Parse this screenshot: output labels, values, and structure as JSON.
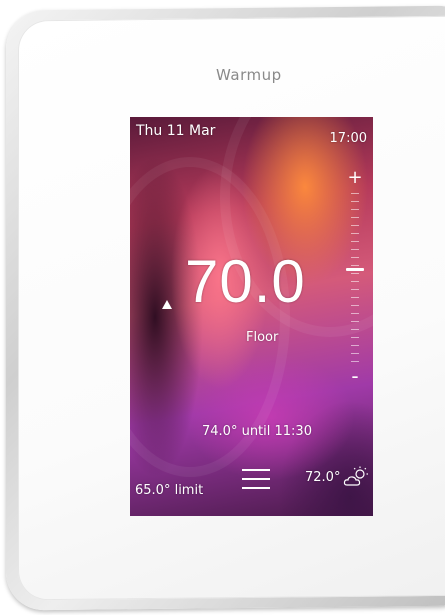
{
  "brand": "Warmup",
  "screen": {
    "date": "Thu 11 Mar",
    "time": "17:00",
    "setpoint": "70.0",
    "trend": "rising",
    "mode": "Floor",
    "schedule": "74.0° until 11:30",
    "limit": "65.0° limit",
    "outdoor_temp": "72.0°",
    "weather_icon": "partly-cloudy-icon",
    "menu_icon": "hamburger-menu-icon",
    "plus_label": "+",
    "minus_label": "-",
    "slider_level": 0.55
  },
  "colors": {
    "screen_text": "#ffffff",
    "brand_text": "#8a8a8a",
    "device_body": "#ffffff"
  }
}
